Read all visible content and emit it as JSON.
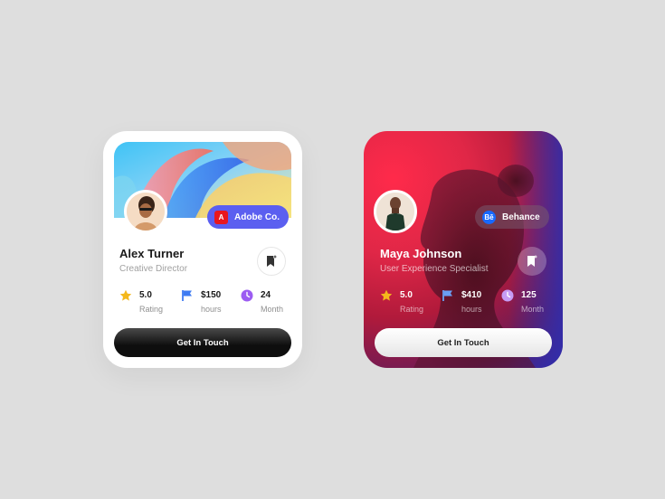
{
  "cards": [
    {
      "company": "Adobe Co.",
      "company_icon": "adobe-icon",
      "company_icon_glyph": "A",
      "name": "Alex Turner",
      "role": "Creative Director",
      "stats": [
        {
          "value": "5.0",
          "label": "Rating",
          "icon": "star-icon",
          "color": "#f4b81c"
        },
        {
          "value": "$150",
          "label": "hours",
          "icon": "flag-icon",
          "color": "#3f7bf2"
        },
        {
          "value": "24",
          "label": "Month",
          "icon": "clock-icon",
          "color": "#9c5cf2"
        }
      ],
      "cta": "Get In Touch"
    },
    {
      "company": "Behance",
      "company_icon": "behance-icon",
      "company_icon_glyph": "Bē",
      "name": "Maya Johnson",
      "role": "User Experience Specialist",
      "stats": [
        {
          "value": "5.0",
          "label": "Rating",
          "icon": "star-icon",
          "color": "#f4b81c"
        },
        {
          "value": "$410",
          "label": "hours",
          "icon": "flag-icon",
          "color": "#6aa0f5"
        },
        {
          "value": "125",
          "label": "Month",
          "icon": "clock-icon",
          "color": "#c69cf5"
        }
      ],
      "cta": "Get In Touch"
    }
  ],
  "colors": {
    "background": "#dedede",
    "adobe_pill": "#5b5ff0",
    "adobe_red": "#e8171f",
    "behance_blue": "#1769ff"
  }
}
